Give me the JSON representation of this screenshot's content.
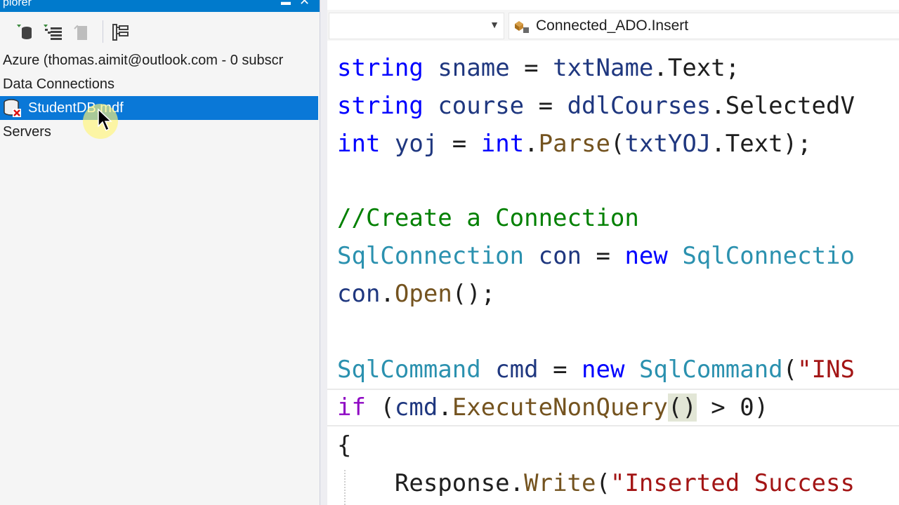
{
  "server_explorer": {
    "title": "plorer",
    "toolbar": [
      "refresh-icon",
      "stop-refresh-icon",
      "connect-to-database-icon",
      "connect-to-server-icon",
      "diagram-icon"
    ],
    "tree": {
      "azure": "Azure (thomas.aimit@outlook.com - 0 subscr",
      "data_connections": "Data Connections",
      "selected_db": "StudentDB.mdf",
      "servers": "Servers"
    }
  },
  "editor": {
    "nav_left": "",
    "nav_right": "Connected_ADO.Insert",
    "code_lines": [
      {
        "tokens": [
          {
            "t": "string",
            "c": "kw"
          },
          {
            "t": " ",
            "c": ""
          },
          {
            "t": "sname",
            "c": "var"
          },
          {
            "t": " = ",
            "c": ""
          },
          {
            "t": "txtName",
            "c": "var"
          },
          {
            "t": ".Text;",
            "c": ""
          }
        ]
      },
      {
        "tokens": [
          {
            "t": "string",
            "c": "kw"
          },
          {
            "t": " ",
            "c": ""
          },
          {
            "t": "course",
            "c": "var"
          },
          {
            "t": " = ",
            "c": ""
          },
          {
            "t": "ddlCourses",
            "c": "var"
          },
          {
            "t": ".SelectedV",
            "c": ""
          }
        ]
      },
      {
        "tokens": [
          {
            "t": "int",
            "c": "kw"
          },
          {
            "t": " ",
            "c": ""
          },
          {
            "t": "yoj",
            "c": "var"
          },
          {
            "t": " = ",
            "c": ""
          },
          {
            "t": "int",
            "c": "kw"
          },
          {
            "t": ".",
            "c": ""
          },
          {
            "t": "Parse",
            "c": "mth"
          },
          {
            "t": "(",
            "c": ""
          },
          {
            "t": "txtYOJ",
            "c": "var"
          },
          {
            "t": ".Text);",
            "c": ""
          }
        ]
      },
      {
        "tokens": []
      },
      {
        "tokens": [
          {
            "t": "//Create a Connection",
            "c": "cm"
          }
        ]
      },
      {
        "tokens": [
          {
            "t": "SqlConnection",
            "c": "ty"
          },
          {
            "t": " ",
            "c": ""
          },
          {
            "t": "con",
            "c": "var"
          },
          {
            "t": " = ",
            "c": ""
          },
          {
            "t": "new",
            "c": "kw"
          },
          {
            "t": " ",
            "c": ""
          },
          {
            "t": "SqlConnectio",
            "c": "ty"
          }
        ]
      },
      {
        "tokens": [
          {
            "t": "con",
            "c": "var"
          },
          {
            "t": ".",
            "c": ""
          },
          {
            "t": "Open",
            "c": "mth"
          },
          {
            "t": "();",
            "c": ""
          }
        ]
      },
      {
        "tokens": []
      },
      {
        "tokens": [
          {
            "t": "SqlCommand",
            "c": "ty"
          },
          {
            "t": " ",
            "c": ""
          },
          {
            "t": "cmd",
            "c": "var"
          },
          {
            "t": " = ",
            "c": ""
          },
          {
            "t": "new",
            "c": "kw"
          },
          {
            "t": " ",
            "c": ""
          },
          {
            "t": "SqlCommand",
            "c": "ty"
          },
          {
            "t": "(",
            "c": ""
          },
          {
            "t": "\"INS",
            "c": "str"
          }
        ]
      },
      {
        "tokens": [
          {
            "t": "if",
            "c": "ctl"
          },
          {
            "t": " (",
            "c": ""
          },
          {
            "t": "cmd",
            "c": "var"
          },
          {
            "t": ".",
            "c": ""
          },
          {
            "t": "ExecuteNonQuery",
            "c": "mth"
          },
          {
            "t": "()",
            "c": "brace-hl"
          },
          {
            "t": " > 0)",
            "c": ""
          }
        ]
      },
      {
        "tokens": [
          {
            "t": "{",
            "c": ""
          }
        ]
      },
      {
        "tokens": [
          {
            "t": "    Response",
            "c": ""
          },
          {
            "t": ".",
            "c": ""
          },
          {
            "t": "Write",
            "c": "mth"
          },
          {
            "t": "(",
            "c": ""
          },
          {
            "t": "\"Inserted Success",
            "c": "str"
          }
        ]
      }
    ]
  }
}
